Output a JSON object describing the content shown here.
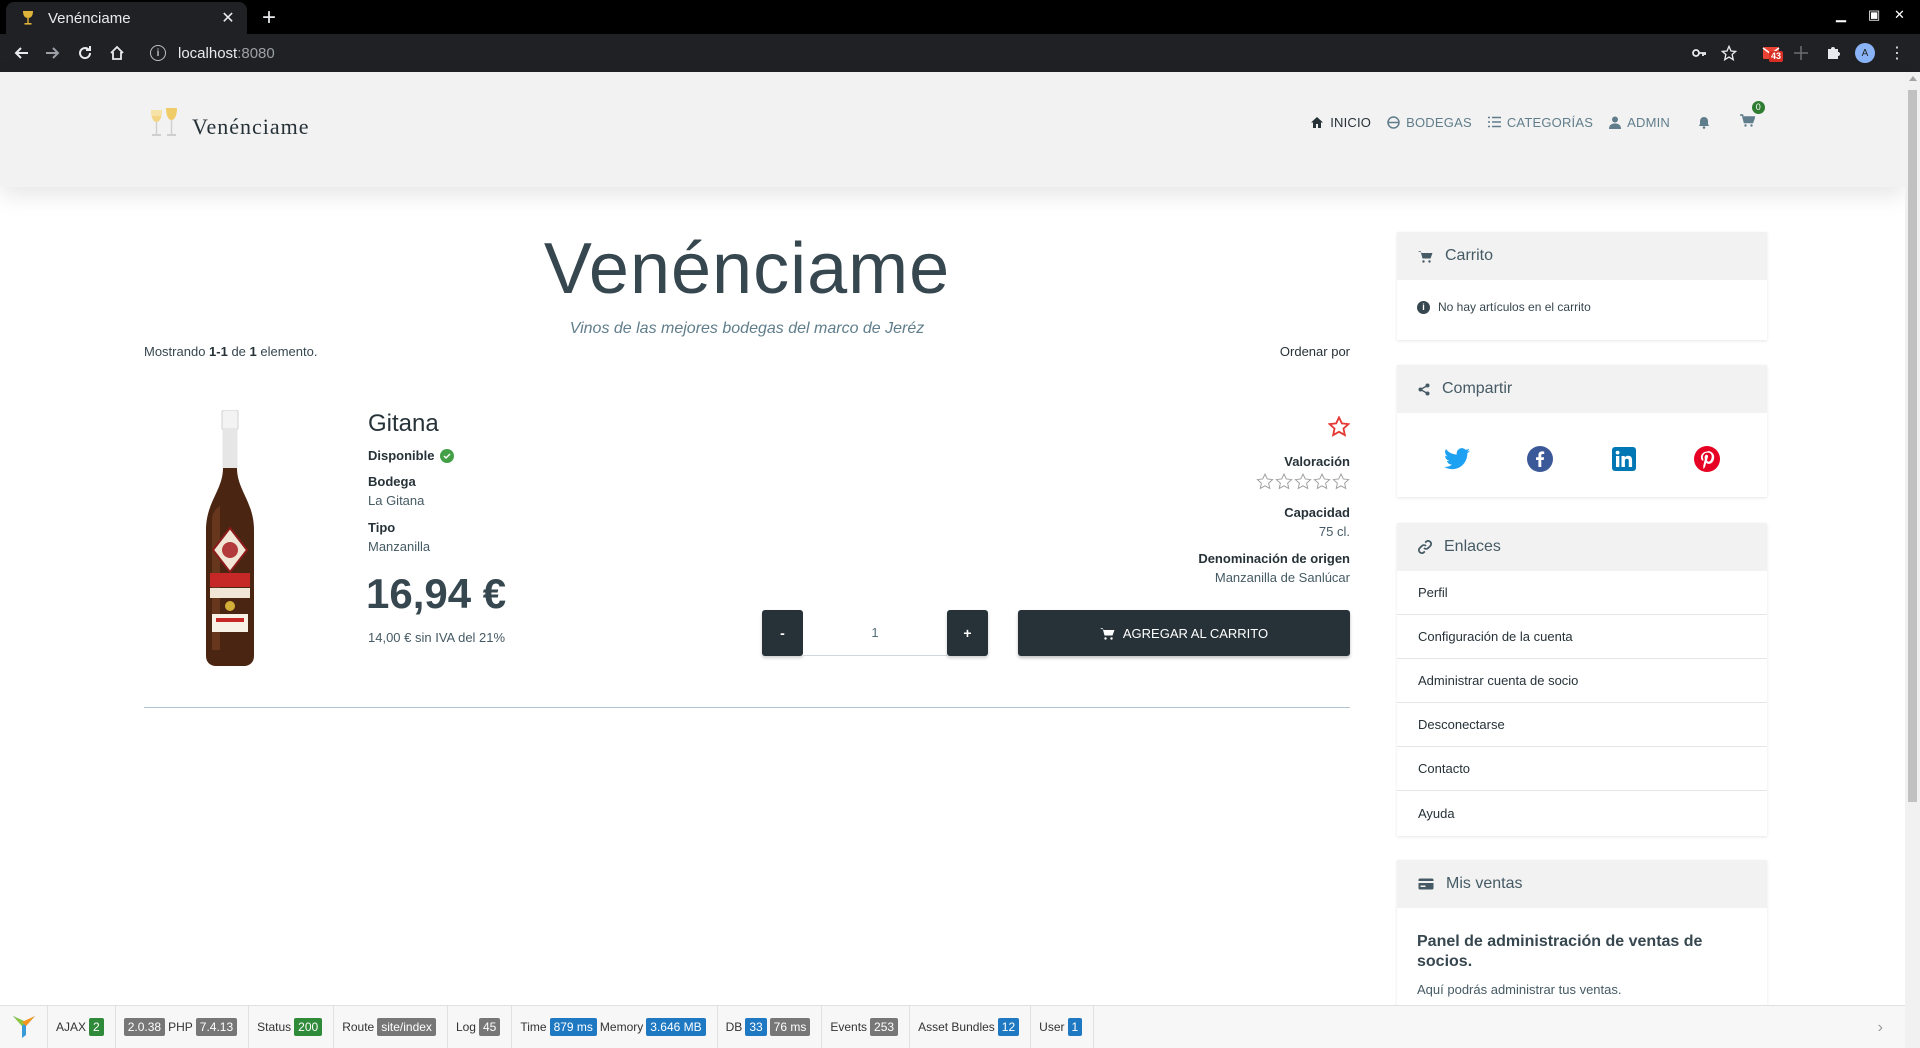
{
  "browser": {
    "tab_title": "Venénciame",
    "url_host": "localhost",
    "url_port": ":8080",
    "extension_badge": "43",
    "profile_initial": "A"
  },
  "site": {
    "brand": "Venénciame",
    "nav": [
      {
        "label": "INICIO",
        "icon": "home-icon",
        "active": true
      },
      {
        "label": "BODEGAS",
        "icon": "barrel-icon",
        "active": false
      },
      {
        "label": "CATEGORÍAS",
        "icon": "list-icon",
        "active": false
      },
      {
        "label": "ADMIN",
        "icon": "user-icon",
        "active": false
      }
    ],
    "cart_count": "0"
  },
  "hero": {
    "title": "Venénciame",
    "subtitle": "Vinos de las mejores bodegas del marco de Jeréz"
  },
  "listing": {
    "summary_prefix": "Mostrando ",
    "summary_range": "1-1",
    "summary_mid": " de ",
    "summary_total": "1",
    "summary_suffix": " elemento.",
    "sort_label": "Ordenar por"
  },
  "product": {
    "name": "Gitana",
    "availability": "Disponible",
    "winery_label": "Bodega",
    "winery": "La Gitana",
    "type_label": "Tipo",
    "type": "Manzanilla",
    "price": "16,94 €",
    "price_net": "14,00 € sin IVA del 21%",
    "rating_label": "Valoración",
    "rating_value": 0,
    "rating_max": 5,
    "capacity_label": "Capacidad",
    "capacity": "75 cl.",
    "origin_label": "Denominación de origen",
    "origin": "Manzanilla de Sanlúcar",
    "qty_minus": "-",
    "qty_value": "1",
    "qty_plus": "+",
    "add_to_cart": "AGREGAR AL CARRITO"
  },
  "sidebar": {
    "cart": {
      "title": "Carrito",
      "empty_msg": "No hay artículos en el carrito"
    },
    "share": {
      "title": "Compartir",
      "networks": [
        "twitter",
        "facebook",
        "linkedin",
        "pinterest"
      ]
    },
    "links": {
      "title": "Enlaces",
      "items": [
        "Perfil",
        "Configuración de la cuenta",
        "Administrar cuenta de socio",
        "Desconectarse",
        "Contacto",
        "Ayuda"
      ]
    },
    "sales": {
      "title": "Mis ventas",
      "heading": "Panel de administración de ventas de socios.",
      "text": "Aquí podrás administrar tus ventas."
    }
  },
  "debug": {
    "ajax_label": "AJAX",
    "ajax_count": "2",
    "yii_version": "2.0.38",
    "php_label": "PHP",
    "php_version": "7.4.13",
    "status_label": "Status",
    "status_code": "200",
    "route_label": "Route",
    "route": "site/index",
    "log_label": "Log",
    "log_count": "45",
    "time_label": "Time",
    "time": "879 ms",
    "memory_label": "Memory",
    "memory": "3.646 MB",
    "db_label": "DB",
    "db_queries": "33",
    "db_time": "76 ms",
    "events_label": "Events",
    "events": "253",
    "bundles_label": "Asset Bundles",
    "bundles": "12",
    "user_label": "User",
    "user": "1"
  },
  "colors": {
    "primary": "#263238",
    "header_bg": "#f2f2f2",
    "available_green": "#43a047",
    "favorite_red": "#e53935",
    "twitter": "#1da1f2",
    "facebook": "#3b5998",
    "linkedin": "#0077b5",
    "pinterest": "#e60023"
  }
}
